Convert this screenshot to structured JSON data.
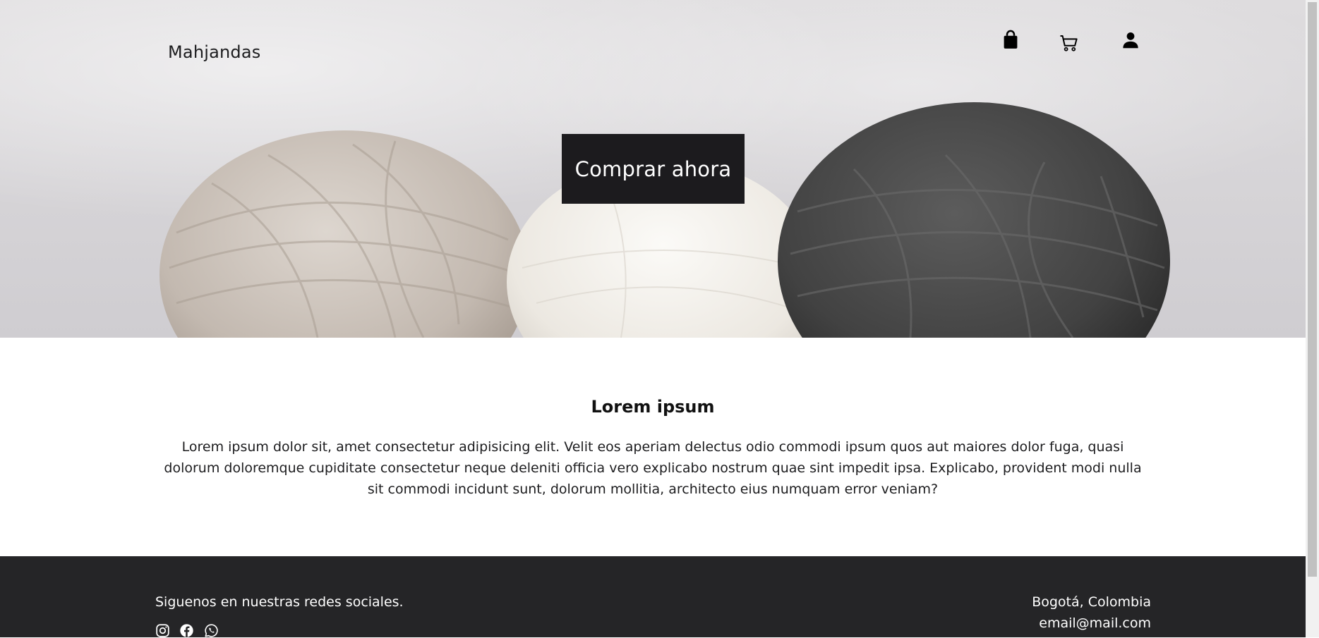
{
  "header": {
    "brand": "Mahjandas",
    "icons": [
      "shopping-bag-icon",
      "cart-icon",
      "user-icon"
    ]
  },
  "hero": {
    "cta_label": "Comprar ahora"
  },
  "section": {
    "title": "Lorem ipsum",
    "body": "Lorem ipsum dolor sit, amet consectetur adipisicing elit. Velit eos aperiam delectus odio commodi ipsum quos aut maiores dolor fuga, quasi dolorum doloremque cupiditate consectetur neque deleniti officia vero explicabo nostrum quae sint impedit ipsa. Explicabo, provident modi nulla sit commodi incidunt sunt, dolorum mollitia, architecto eius numquam error veniam?"
  },
  "footer": {
    "follow_text": "Siguenos en nuestras redes sociales.",
    "social_icons": [
      "instagram-icon",
      "facebook-icon",
      "whatsapp-icon"
    ],
    "city": "Bogotá, Colombia",
    "email": "email@mail.com"
  },
  "colors": {
    "footer_bg": "#252527",
    "cta_bg": "#1c1b1e",
    "text": "#1c1c1e"
  }
}
